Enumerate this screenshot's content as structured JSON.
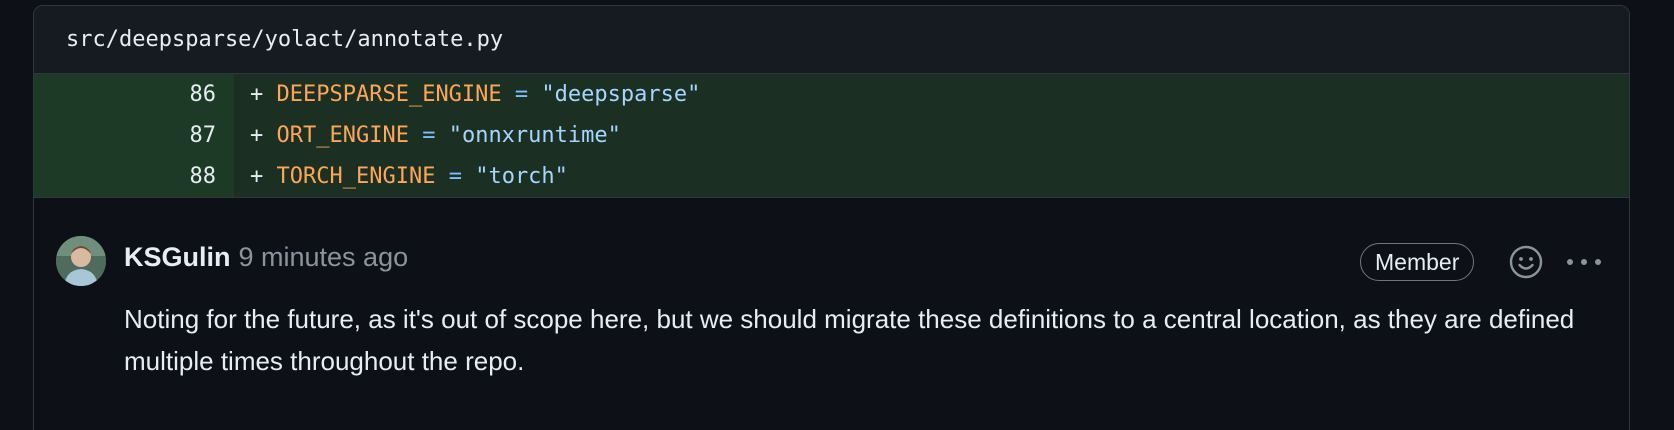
{
  "file": {
    "path": "src/deepsparse/yolact/annotate.py"
  },
  "diff": {
    "lines": [
      {
        "num": "86",
        "plus": "+ ",
        "name": "DEEPSPARSE_ENGINE",
        "op": " = ",
        "value": "\"deepsparse\""
      },
      {
        "num": "87",
        "plus": "+ ",
        "name": "ORT_ENGINE",
        "op": " = ",
        "value": "\"onnxruntime\""
      },
      {
        "num": "88",
        "plus": "+ ",
        "name": "TORCH_ENGINE",
        "op": " = ",
        "value": "\"torch\""
      }
    ]
  },
  "comment": {
    "author": "KSGulin",
    "time": "9 minutes ago",
    "badge": "Member",
    "body": "Noting for the future, as it's out of scope here, but we should migrate these definitions to a central location, as they are defined multiple times throughout the repo.",
    "icons": {
      "avatar": "avatar",
      "emoji": "smiley-icon",
      "more": "kebab-horizontal-icon"
    }
  },
  "colors": {
    "background": "#0d1117",
    "header_bg": "#161b22",
    "added_line_bg": "#1b2f22",
    "added_num_bg": "#1d3a26",
    "identifier": "#ffa657",
    "string": "#a5d6ff",
    "muted_text": "#8b949e"
  }
}
